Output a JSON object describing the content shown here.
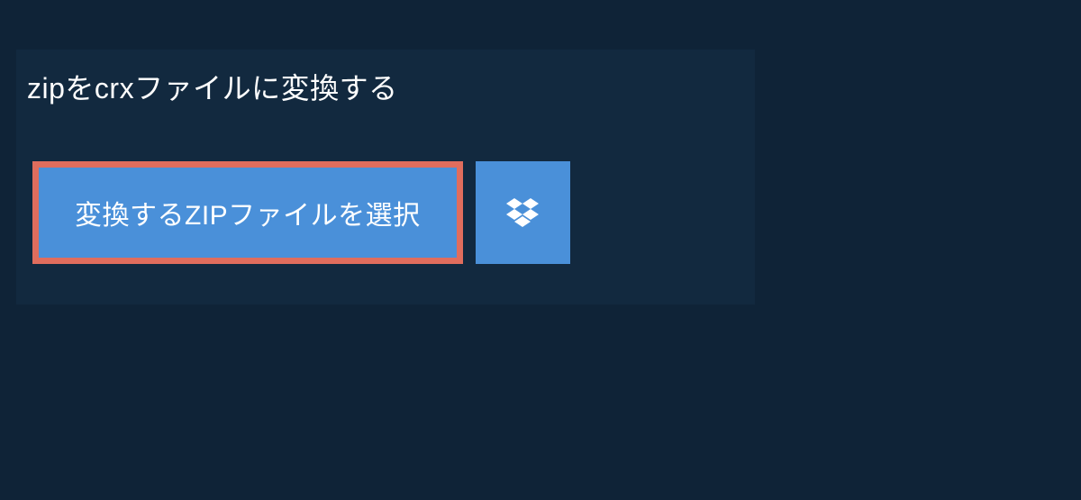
{
  "header": {
    "title": "zipをcrxファイルに変換する"
  },
  "actions": {
    "select_file_label": "変換するZIPファイルを選択"
  }
}
